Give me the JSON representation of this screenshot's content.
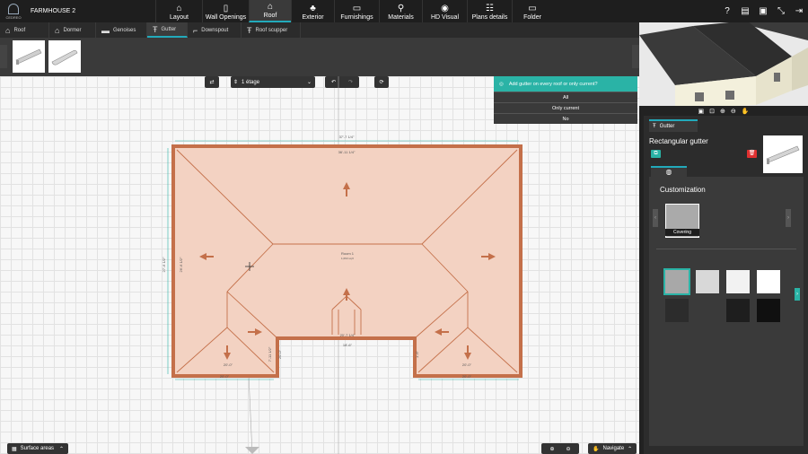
{
  "app": {
    "logo_text": "CEDREO",
    "project_title": "FARMHOUSE 2"
  },
  "nav": [
    {
      "label": "Layout",
      "icon": "⌂",
      "active": false
    },
    {
      "label": "Wall Openings",
      "icon": "▯",
      "active": false
    },
    {
      "label": "Roof",
      "icon": "⌂",
      "active": true
    },
    {
      "label": "Exterior",
      "icon": "♣",
      "active": false
    },
    {
      "label": "Furnishings",
      "icon": "▭",
      "active": false
    },
    {
      "label": "Materials",
      "icon": "⚲",
      "active": false
    },
    {
      "label": "HD Visual",
      "icon": "◉",
      "active": false
    },
    {
      "label": "Plans details",
      "icon": "☷",
      "active": false
    },
    {
      "label": "Folder",
      "icon": "▭",
      "active": false
    }
  ],
  "header_icons": [
    "help-icon",
    "comment-icon",
    "save-icon",
    "fullscreen-icon",
    "logout-icon"
  ],
  "header_glyphs": [
    "?",
    "▤",
    "▣",
    "⤡",
    "⇥"
  ],
  "subtabs": [
    {
      "label": "Roof",
      "icon": "⌂"
    },
    {
      "label": "Dormer",
      "icon": "⌂"
    },
    {
      "label": "Genoises",
      "icon": "▬"
    },
    {
      "label": "Gutter",
      "icon": "Ŧ",
      "active": true
    },
    {
      "label": "Downspout",
      "icon": "⌐"
    },
    {
      "label": "Roof scupper",
      "icon": "Ŧ"
    }
  ],
  "toolbar": {
    "floor": "1 étage",
    "swap_glyph": "⇄",
    "undo_glyph": "↶",
    "redo_glyph": "↷",
    "reset_glyph": "⟳",
    "floor_glyph": "⇕",
    "floor_dropdown": "⌄"
  },
  "dialog": {
    "title": "Add gutter on every roof or only current?",
    "options": [
      "All",
      "Only current",
      "No"
    ]
  },
  "plan": {
    "top_dim": "37'-7 1/4\"",
    "inner_top_dim": "36'-11 1/4\"",
    "left_dim": "27'-6 1/2\"",
    "left_inner_dim": "26'-6 1/2\"",
    "room_label": "Room 1",
    "room_area": "1,063 sq ft",
    "dim_1": "20'-0\"",
    "dim_2": "20'-0\"",
    "dim_3": "7'-11 1/2\"",
    "dim_4": "20'-7 1/4\"",
    "dim_5": "18'-6\"",
    "dim_6": "20'-0\"",
    "dim_7": "20'-0\"",
    "dim_8": "20'-0\"",
    "dim_9": "1'-6\""
  },
  "bottom": {
    "surface_label": "Surface areas",
    "navigate_label": "Navigate",
    "zoom_in_glyph": "⊕",
    "zoom_out_glyph": "⊖",
    "hand_glyph": "✋",
    "chev_glyph": "⌃"
  },
  "view3d_icons": [
    "floorplan-icon",
    "camera-icon",
    "zoom-in-icon",
    "zoom-out-icon",
    "hand-icon"
  ],
  "view3d_glyphs": [
    "▣",
    "⊡",
    "⊕",
    "⊖",
    "✋"
  ],
  "panel": {
    "tab": "Gutter",
    "tab_glyph": "Ŧ",
    "title": "Rectangular gutter",
    "custom_tab_glyph": "◍",
    "custom_title": "Customization",
    "covering_label": "Covering",
    "copy_glyph": "⧉",
    "delete_glyph": "🗑",
    "left_arrow": "‹",
    "right_arrow": "›",
    "swatches": [
      "#a8a8a8",
      "#d8d8d8",
      "#f2f2f2",
      "#ffffff",
      "#2c2c2c",
      "#3a3a3a",
      "#1e1e1e",
      "#101010"
    ]
  },
  "colors": {
    "accent": "#2ab3a6",
    "roof_fill": "#f3d2c2",
    "roof_stroke": "#c4704a"
  }
}
